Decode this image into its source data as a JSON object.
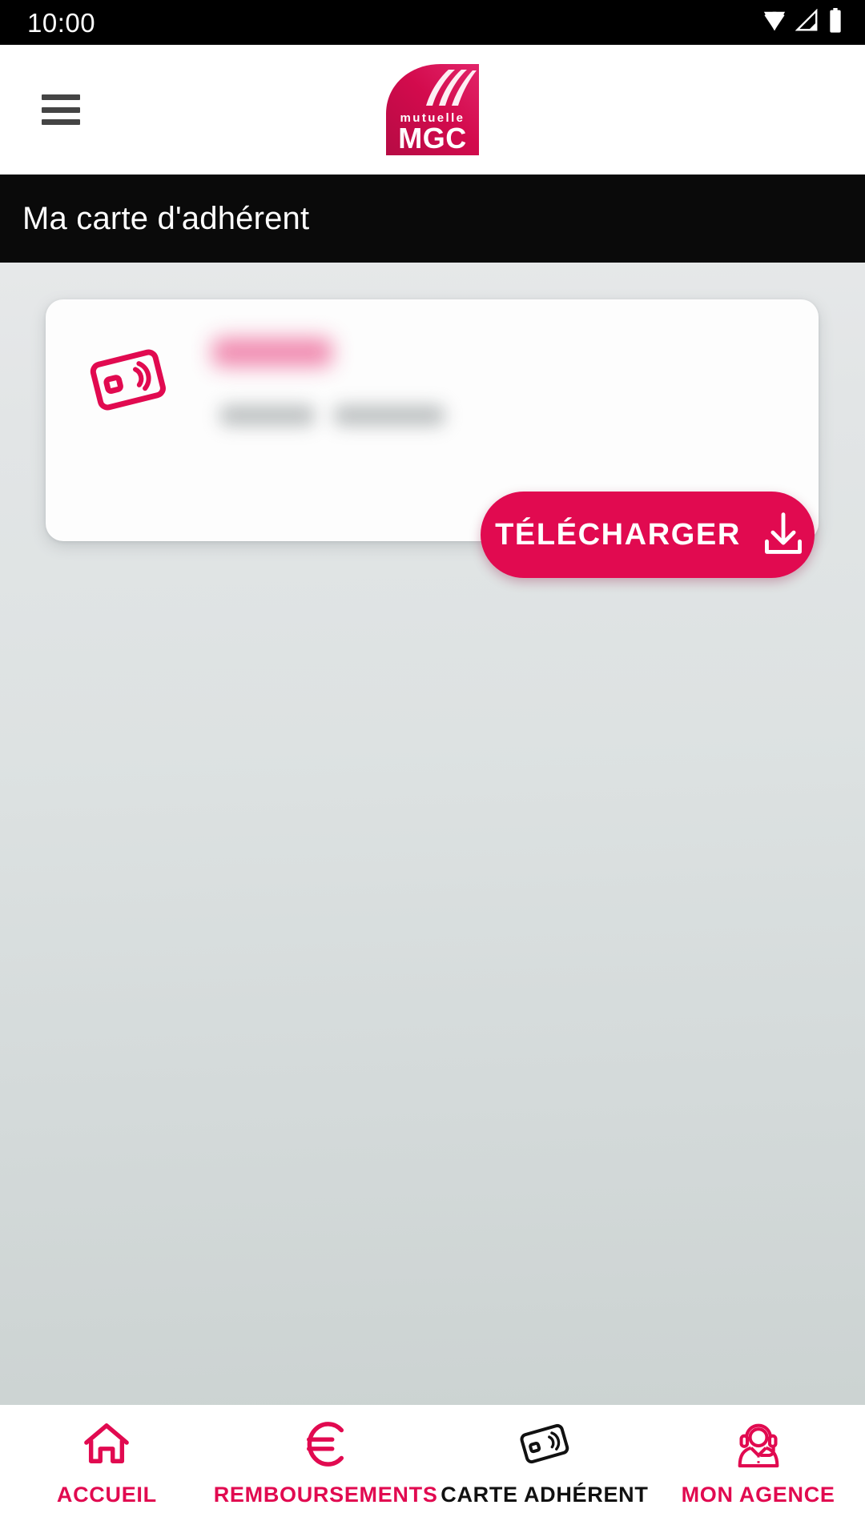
{
  "status_bar": {
    "time": "10:00",
    "icons": [
      "wifi-icon",
      "cellular-signal-icon",
      "battery-icon"
    ]
  },
  "app_bar": {
    "menu_icon": "hamburger-menu-icon",
    "logo": {
      "name": "mgc-logo",
      "small_text": "mutuelle",
      "big_text": "MGC"
    }
  },
  "title_bar": {
    "title": "Ma carte d'adhérent"
  },
  "card": {
    "icon": "contactless-card-icon",
    "member_name": "",
    "member_details": "",
    "download_button": {
      "label": "TÉLÉCHARGER",
      "icon": "download-icon"
    }
  },
  "bottom_nav": {
    "items": [
      {
        "label": "ACCUEIL",
        "icon": "home-icon",
        "state": "accent"
      },
      {
        "label": "REMBOURSEMENTS",
        "icon": "euro-icon",
        "state": "accent"
      },
      {
        "label": "CARTE ADHÉRENT",
        "icon": "contactless-card-icon",
        "state": "active"
      },
      {
        "label": "MON AGENCE",
        "icon": "support-agent-icon",
        "state": "accent"
      }
    ]
  },
  "colors": {
    "brand_crimson": "#e10a50",
    "title_bar_bg": "#0a0a0a",
    "status_bar_bg": "#000000",
    "content_bg_top": "#e6e8e9",
    "content_bg_bottom": "#ccd3d2",
    "card_bg": "#fdfdfd",
    "active_nav": "#111111"
  }
}
